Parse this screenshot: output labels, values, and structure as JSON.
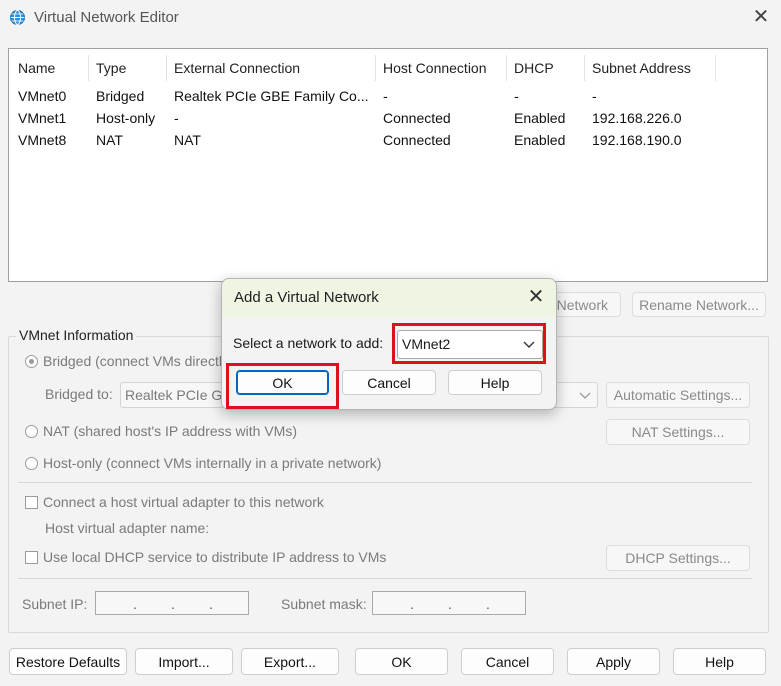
{
  "window": {
    "title": "Virtual Network Editor"
  },
  "table": {
    "columns": [
      "Name",
      "Type",
      "External Connection",
      "Host Connection",
      "DHCP",
      "Subnet Address"
    ],
    "rows": [
      [
        "VMnet0",
        "Bridged",
        "Realtek PCIe GBE Family Co...",
        "-",
        "-",
        "-"
      ],
      [
        "VMnet1",
        "Host-only",
        "-",
        "Connected",
        "Enabled",
        "192.168.226.0"
      ],
      [
        "VMnet8",
        "NAT",
        "NAT",
        "Connected",
        "Enabled",
        "192.168.190.0"
      ]
    ]
  },
  "list_buttons": {
    "remove_network": "Network",
    "rename_network": "Rename Network..."
  },
  "vmnet_info": {
    "group_label": "VMnet Information",
    "bridged_label": "Bridged (connect VMs directl",
    "bridged_to_label": "Bridged to:",
    "bridged_to_value": "Realtek PCIe G",
    "automatic_settings": "Automatic Settings...",
    "nat_label": "NAT (shared host's IP address with VMs)",
    "nat_settings": "NAT Settings...",
    "hostonly_label": "Host-only (connect VMs internally in a private network)",
    "connect_adapter_label": "Connect a host virtual adapter to this network",
    "adapter_name_label": "Host virtual adapter name:",
    "dhcp_label": "Use local DHCP service to distribute IP address to VMs",
    "dhcp_settings": "DHCP Settings...",
    "subnet_ip_label": "Subnet IP:",
    "subnet_mask_label": "Subnet mask:",
    "ip_dot": "."
  },
  "bottom_buttons": {
    "restore_defaults": "Restore Defaults",
    "import": "Import...",
    "export": "Export...",
    "ok": "OK",
    "cancel": "Cancel",
    "apply": "Apply",
    "help": "Help"
  },
  "dialog": {
    "title": "Add a Virtual Network",
    "select_label": "Select a network to add:",
    "selected_network": "VMnet2",
    "ok": "OK",
    "cancel": "Cancel",
    "help": "Help"
  },
  "colors": {
    "highlight": "#e0101b",
    "dialog_title_bg": "#eef5e3",
    "window_bg": "#f3f3f3"
  },
  "icons": {
    "app": "globe-network-icon",
    "close": "close-icon",
    "dropdown": "chevron-down-icon"
  }
}
